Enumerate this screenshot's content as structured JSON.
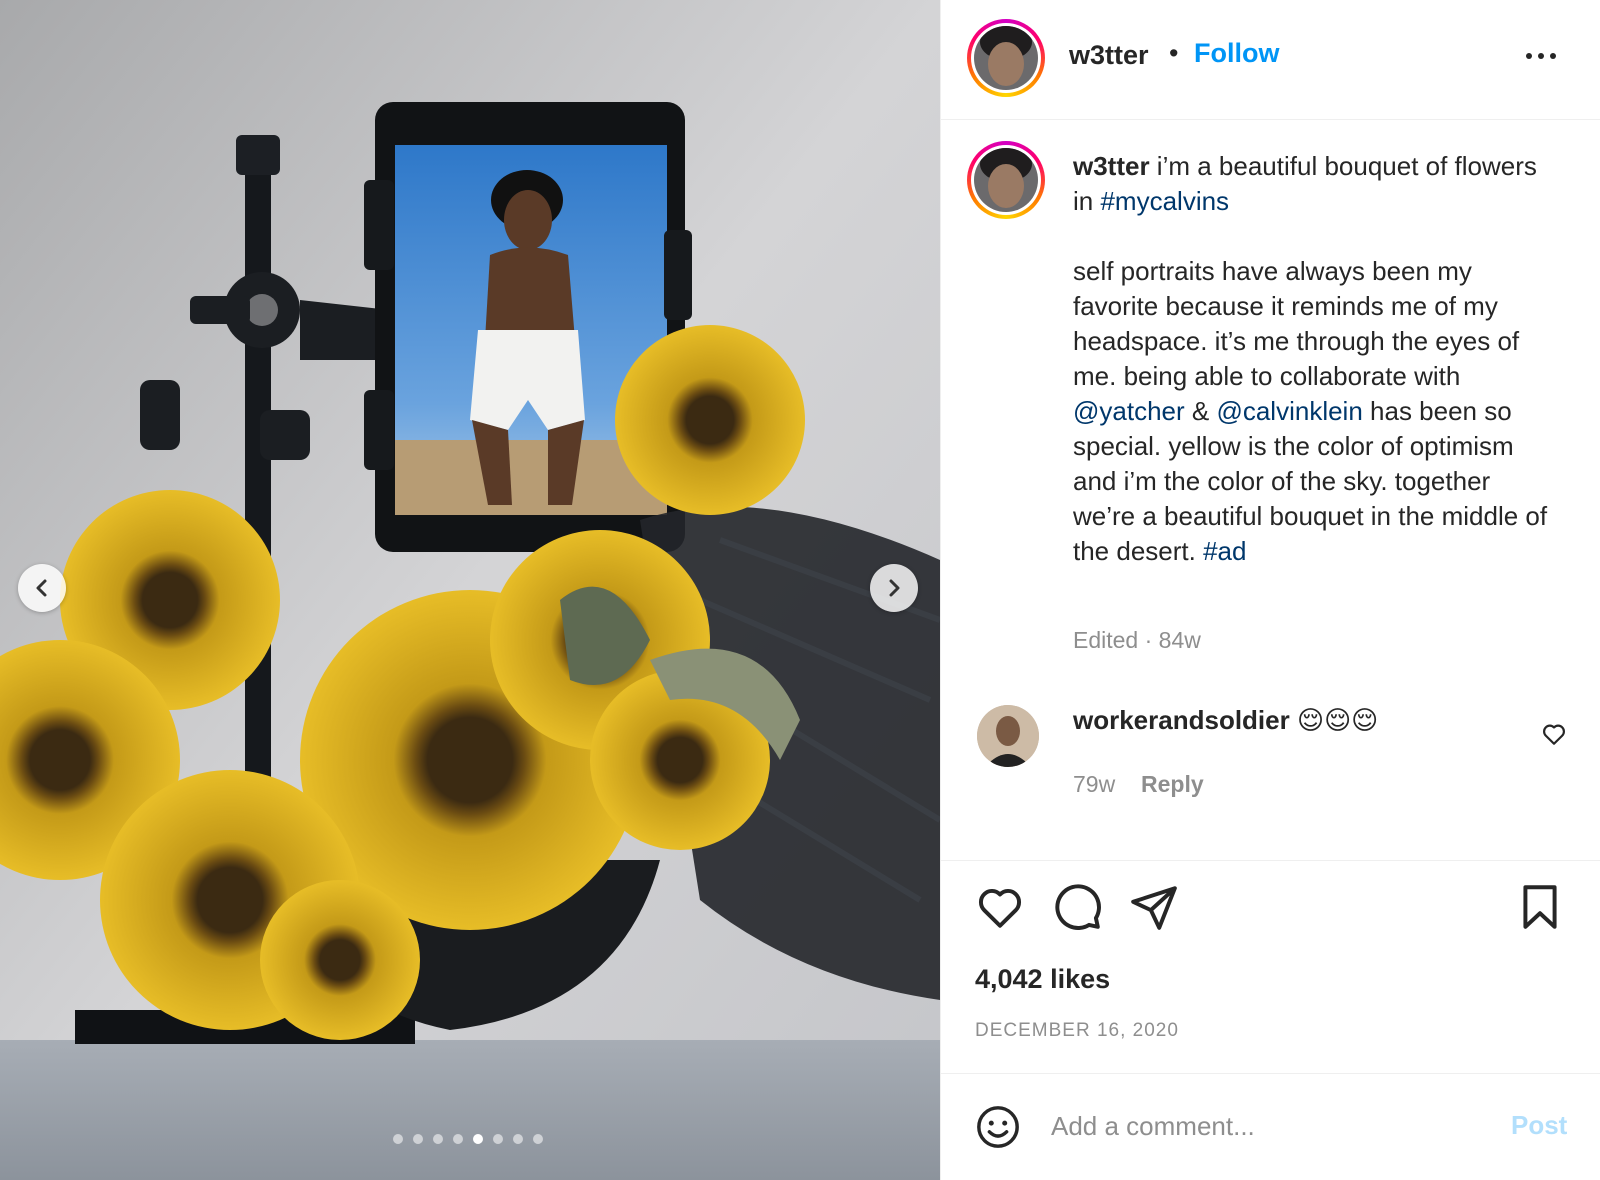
{
  "media": {
    "carousel_dots": 8,
    "active_dot_index": 4,
    "prev_icon": "chevron-left-icon",
    "next_icon": "chevron-right-icon"
  },
  "header": {
    "username": "w3tter",
    "separator": "•",
    "follow_label": "Follow",
    "more_icon": "more-options-icon"
  },
  "caption": {
    "username": "w3tter",
    "line1_text": " i’m a beautiful bouquet of flowers in ",
    "hashtag1": "#mycalvins",
    "body_part1": "self portraits have always been my favorite because it reminds me of my headspace. it’s me through the eyes of me. being able to collaborate with ",
    "mention1": "@yatcher",
    "amp": " & ",
    "mention2": "@calvinklein",
    "body_part2": " has been so special. yellow is the color of optimism and i’m the color of the sky. together we’re a beautiful bouquet in the middle of the desert. ",
    "hashtag2": "#ad",
    "meta": "Edited · 84w"
  },
  "comment": {
    "username": "workerandsoldier",
    "emojis": "😌😌😌",
    "time": "79w",
    "reply_label": "Reply"
  },
  "actions": {
    "likes": "4,042 likes",
    "date": "DECEMBER 16, 2020"
  },
  "comment_bar": {
    "placeholder": "Add a comment...",
    "post_label": "Post"
  },
  "colors": {
    "accent": "#0095f6",
    "link": "#00376b",
    "muted": "#8e8e8e",
    "post_disabled": "#b2dffc"
  }
}
